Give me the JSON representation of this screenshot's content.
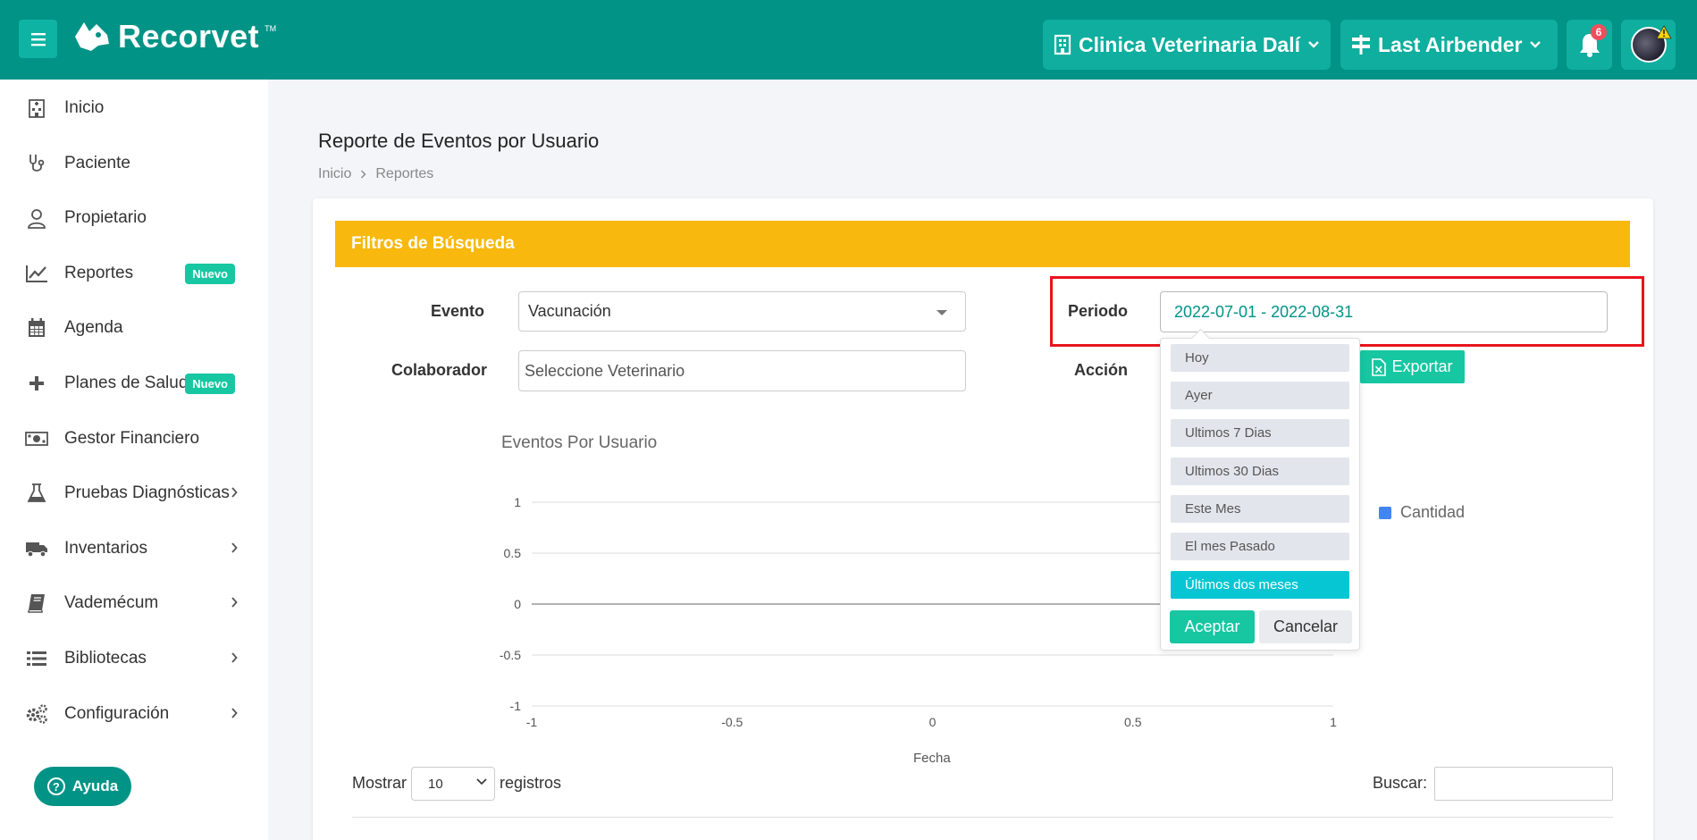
{
  "topbar": {
    "brand": "Recorvet",
    "brand_tm": "TM",
    "clinic": "Clinica Veterinaria Dalí",
    "user": "Last Airbender",
    "notifications": "6"
  },
  "sidebar": {
    "items": [
      {
        "label": "Inicio",
        "icon": "hospital-icon"
      },
      {
        "label": "Paciente",
        "icon": "stethoscope-icon"
      },
      {
        "label": "Propietario",
        "icon": "user-icon"
      },
      {
        "label": "Reportes",
        "icon": "chart-line-icon",
        "badge": "Nuevo"
      },
      {
        "label": "Agenda",
        "icon": "calendar-icon"
      },
      {
        "label": "Planes de Salud",
        "icon": "plus-icon",
        "badge": "Nuevo"
      },
      {
        "label": "Gestor Financiero",
        "icon": "money-icon"
      },
      {
        "label": "Pruebas Diagnósticas",
        "icon": "flask-icon"
      },
      {
        "label": "Inventarios",
        "icon": "truck-icon"
      },
      {
        "label": "Vademécum",
        "icon": "book-icon"
      },
      {
        "label": "Bibliotecas",
        "icon": "list-icon"
      },
      {
        "label": "Configuración",
        "icon": "gears-icon"
      }
    ],
    "help": "Ayuda"
  },
  "page": {
    "title": "Reporte de Eventos por Usuario",
    "breadcrumb": [
      "Inicio",
      "Reportes"
    ]
  },
  "filters": {
    "header": "Filtros de Búsqueda",
    "evento_label": "Evento",
    "evento_value": "Vacunación",
    "colaborador_label": "Colaborador",
    "colaborador_placeholder": "Seleccione Veterinario",
    "periodo_label": "Periodo",
    "periodo_value": "2022-07-01 - 2022-08-31",
    "accion_label": "Acción",
    "export_label": "Exportar"
  },
  "daterange": {
    "ranges": [
      "Hoy",
      "Ayer",
      "Ultimos 7 Dias",
      "Ultimos 30 Dias",
      "Este Mes",
      "El mes Pasado",
      "Últimos dos meses"
    ],
    "active_index": 6,
    "accept": "Aceptar",
    "cancel": "Cancelar"
  },
  "chart_data": {
    "type": "line",
    "title": "Eventos Por Usuario",
    "xlabel": "Fecha",
    "ylabel": "",
    "x_ticks": [
      "-1",
      "-0.5",
      "0",
      "0.5",
      "1"
    ],
    "y_ticks": [
      "1",
      "0.5",
      "0",
      "-0.5",
      "-1"
    ],
    "xlim": [
      -1,
      1
    ],
    "ylim": [
      -1,
      1
    ],
    "series": [
      {
        "name": "Cantidad",
        "values": []
      }
    ],
    "legend": "right",
    "grid": true,
    "series_color": "#4285f4"
  },
  "table": {
    "show_label": "Mostrar",
    "page_length": "10",
    "records_label": "registros",
    "search_label": "Buscar:"
  },
  "colors": {
    "primary": "#019386",
    "warning_header": "#f8b80e",
    "success": "#16c7a2",
    "active_range": "#07c6d4",
    "highlight": "#e8141c"
  }
}
